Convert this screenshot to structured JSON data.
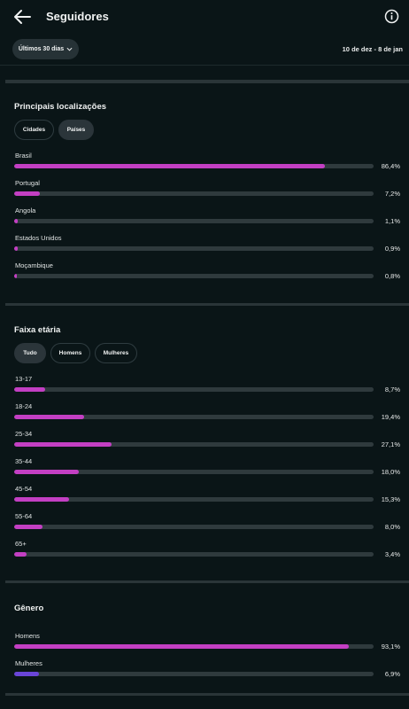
{
  "header": {
    "title": "Seguidores"
  },
  "filter": {
    "period": "Últimos 30 dias",
    "date_range": "10 de dez - 8 de jan"
  },
  "locations": {
    "title": "Principais localizações",
    "tabs": [
      "Cidades",
      "Países"
    ],
    "selected_tab": "Países",
    "rows": [
      {
        "label": "Brasil",
        "value": 86.4,
        "pct": "86,4%"
      },
      {
        "label": "Portugal",
        "value": 7.2,
        "pct": "7,2%"
      },
      {
        "label": "Angola",
        "value": 1.1,
        "pct": "1,1%"
      },
      {
        "label": "Estados Unidos",
        "value": 0.9,
        "pct": "0,9%"
      },
      {
        "label": "Moçambique",
        "value": 0.8,
        "pct": "0,8%"
      }
    ]
  },
  "age": {
    "title": "Faixa etária",
    "tabs": [
      "Tudo",
      "Homens",
      "Mulheres"
    ],
    "selected_tab": "Tudo",
    "rows": [
      {
        "label": "13-17",
        "value": 8.7,
        "pct": "8,7%"
      },
      {
        "label": "18-24",
        "value": 19.4,
        "pct": "19,4%"
      },
      {
        "label": "25-34",
        "value": 27.1,
        "pct": "27,1%"
      },
      {
        "label": "35-44",
        "value": 18.0,
        "pct": "18,0%"
      },
      {
        "label": "45-54",
        "value": 15.3,
        "pct": "15,3%"
      },
      {
        "label": "55-64",
        "value": 8.0,
        "pct": "8,0%"
      },
      {
        "label": "65+",
        "value": 3.4,
        "pct": "3,4%"
      }
    ]
  },
  "gender": {
    "title": "Gênero",
    "rows": [
      {
        "label": "Homens",
        "value": 93.1,
        "pct": "93,1%"
      },
      {
        "label": "Mulheres",
        "value": 6.9,
        "pct": "6,9%"
      }
    ]
  },
  "colors": {
    "bar_pink": "#c33fc3",
    "bar_purple": "#6a45d8",
    "track": "#2f3a3d",
    "background": "#0a1517"
  }
}
